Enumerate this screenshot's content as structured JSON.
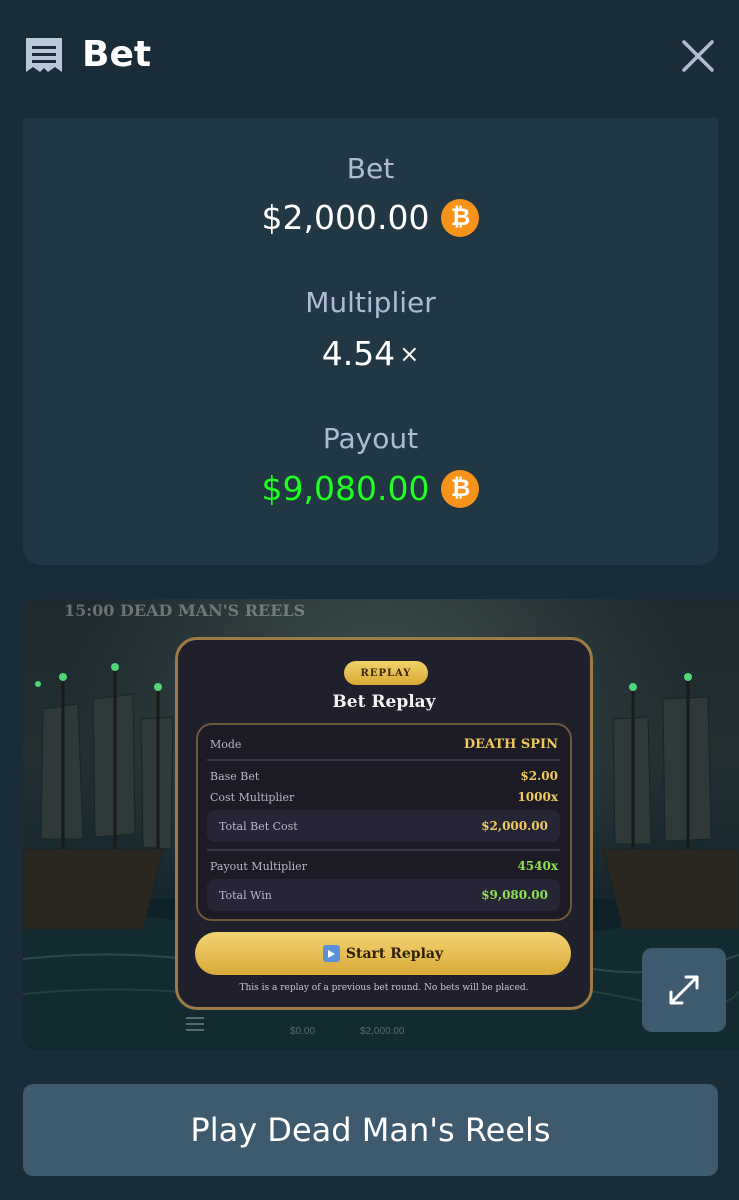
{
  "header": {
    "title": "Bet",
    "icon": "receipt-icon",
    "close_icon": "close-icon"
  },
  "summary": {
    "bet_label": "Bet",
    "bet_value": "$2,000.00",
    "multiplier_label": "Multiplier",
    "multiplier_value": "4.54",
    "multiplier_suffix": "×",
    "payout_label": "Payout",
    "payout_value": "$9,080.00",
    "currency_icon": "bitcoin-icon",
    "currency_symbol": "₿",
    "payout_color": "#1fff20",
    "currency_color": "#f7931a"
  },
  "preview": {
    "game_time": "15:00 DEAD MAN'S REELS",
    "ghost_bar": {
      "balance": "$0.00",
      "bet": "$2,000.00"
    },
    "modal": {
      "badge": "REPLAY",
      "title": "Bet Replay",
      "mode_label": "Mode",
      "mode_value": "DEATH SPIN",
      "base_bet_label": "Base Bet",
      "base_bet_value": "$2.00",
      "cost_mult_label": "Cost Multiplier",
      "cost_mult_value": "1000x",
      "total_cost_label": "Total Bet Cost",
      "total_cost_value": "$2,000.00",
      "payout_mult_label": "Payout Multiplier",
      "payout_mult_value": "4540x",
      "total_win_label": "Total Win",
      "total_win_value": "$9,080.00",
      "start_label": "Start Replay",
      "note": "This is a replay of a previous bet round. No bets will be placed."
    },
    "expand_icon": "expand-icon"
  },
  "play_button": "Play Dead Man's Reels"
}
